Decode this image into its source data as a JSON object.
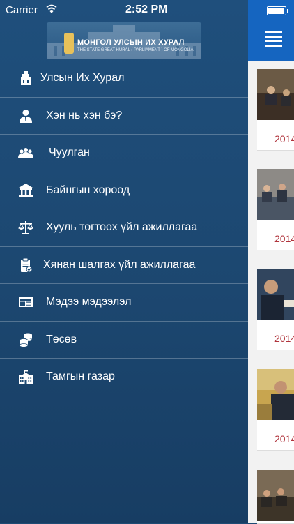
{
  "status": {
    "carrier": "Carrier",
    "time": "2:52 PM"
  },
  "logo": {
    "title": "МОНГОЛ УЛСЫН ИХ ХУРАЛ",
    "subtitle": "THE STATE GREAT HURAL ( PARLIAMENT ) OF MONGOLIA"
  },
  "menu": [
    {
      "label": "Улсын Их Хурал",
      "icon": "parliament-building-icon"
    },
    {
      "label": "Хэн нь хэн бэ?",
      "icon": "person-icon"
    },
    {
      "label": "Чуулган",
      "icon": "group-meeting-icon"
    },
    {
      "label": "Байнгын хороод",
      "icon": "institution-icon"
    },
    {
      "label": "Хууль тогтоох үйл ажиллагаа",
      "icon": "scales-icon"
    },
    {
      "label": "Хянан шалгах үйл ажиллагаа",
      "icon": "clipboard-check-icon"
    },
    {
      "label": "Мэдээ мэдээлэл",
      "icon": "newspaper-icon"
    },
    {
      "label": "Төсөв",
      "icon": "coins-icon"
    },
    {
      "label": "Тамгын газар",
      "icon": "office-building-icon"
    }
  ],
  "news": [
    {
      "date": "2014"
    },
    {
      "date": "2014"
    },
    {
      "date": "2014"
    },
    {
      "date": "2014"
    }
  ],
  "colors": {
    "drawer": "#1d4a73",
    "header": "#1565c0",
    "date": "#b0343c"
  }
}
